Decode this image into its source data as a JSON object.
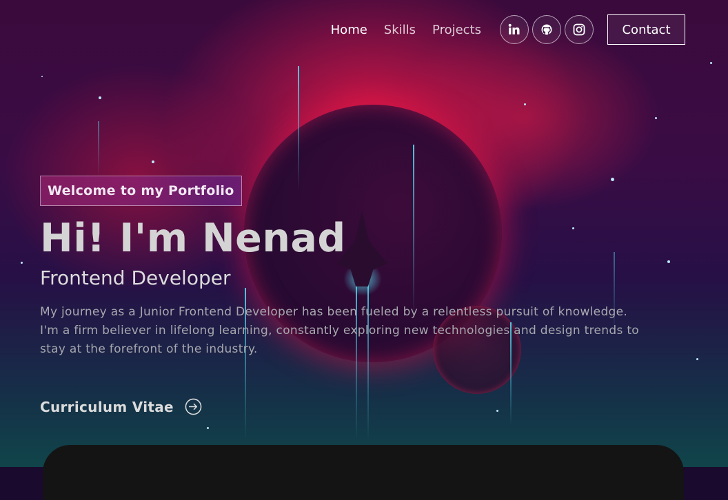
{
  "nav": {
    "links": [
      "Home",
      "Skills",
      "Projects"
    ],
    "socials": [
      {
        "name": "linkedin-icon",
        "glyph": "in"
      },
      {
        "name": "github-icon",
        "glyph": "github"
      },
      {
        "name": "instagram-icon",
        "glyph": "instagram"
      }
    ],
    "contact_label": "Contact"
  },
  "hero": {
    "tagline": "Welcome to my Portfolio",
    "title": "Hi! I'm Nenad",
    "subtitle": "Frontend Developer",
    "description": "My journey as a Junior Frontend Developer has been fueled by a relentless pursuit of knowledge. I'm a firm believer in lifelong learning, constantly exploring new technologies and design trends to stay at the forefront of the industry.",
    "cv_label": "Curriculum Vitae"
  },
  "colors": {
    "accent_red": "#e81a46",
    "background": "#1a0a2e",
    "panel": "#141414"
  }
}
